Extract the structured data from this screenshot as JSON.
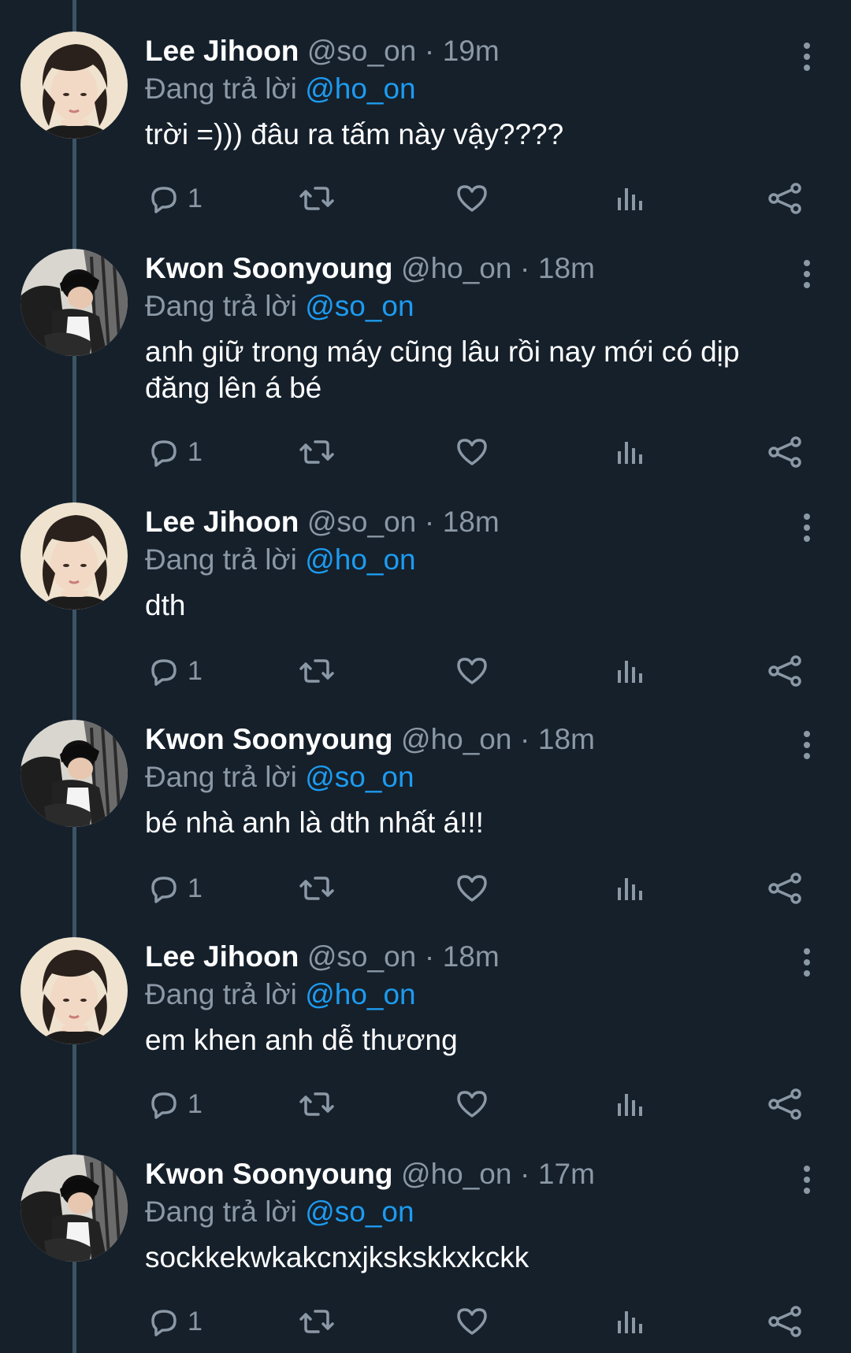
{
  "colors": {
    "background": "#15202b",
    "text": "#ffffff",
    "secondary": "#8b98a5",
    "accent": "#1d9bf0",
    "thread_line": "#3d5466"
  },
  "reply_prefix": "Đang trả lời",
  "tweets": [
    {
      "name": "Lee Jihoon",
      "handle": "@so_on",
      "separator": "·",
      "time": "19m",
      "reply_to": "@ho_on",
      "text": "trời =))) đâu ra tấm này vậy????",
      "reply_count": "1",
      "avatar": "avatar-lee-jihoon"
    },
    {
      "name": "Kwon Soonyoung",
      "handle": "@ho_on",
      "separator": "·",
      "time": "18m",
      "reply_to": "@so_on",
      "text": "anh giữ trong máy cũng lâu rồi nay mới có dịp đăng lên á bé",
      "reply_count": "1",
      "avatar": "avatar-kwon-soonyoung"
    },
    {
      "name": "Lee Jihoon",
      "handle": "@so_on",
      "separator": "·",
      "time": "18m",
      "reply_to": "@ho_on",
      "text": "dth",
      "reply_count": "1",
      "avatar": "avatar-lee-jihoon"
    },
    {
      "name": "Kwon Soonyoung",
      "handle": "@ho_on",
      "separator": "·",
      "time": "18m",
      "reply_to": "@so_on",
      "text": "bé nhà anh là dth nhất á!!!",
      "reply_count": "1",
      "avatar": "avatar-kwon-soonyoung"
    },
    {
      "name": "Lee Jihoon",
      "handle": "@so_on",
      "separator": "·",
      "time": "18m",
      "reply_to": "@ho_on",
      "text": "em khen anh dễ thương",
      "reply_count": "1",
      "avatar": "avatar-lee-jihoon"
    },
    {
      "name": "Kwon Soonyoung",
      "handle": "@ho_on",
      "separator": "·",
      "time": "17m",
      "reply_to": "@so_on",
      "text": "sockkekwkakcnxjkskskkxkckk",
      "reply_count": "1",
      "avatar": "avatar-kwon-soonyoung"
    }
  ],
  "icons": {
    "reply": "reply-icon",
    "retweet": "retweet-icon",
    "like": "heart-icon",
    "views": "views-icon",
    "share": "share-icon",
    "more": "more-vertical-icon"
  }
}
